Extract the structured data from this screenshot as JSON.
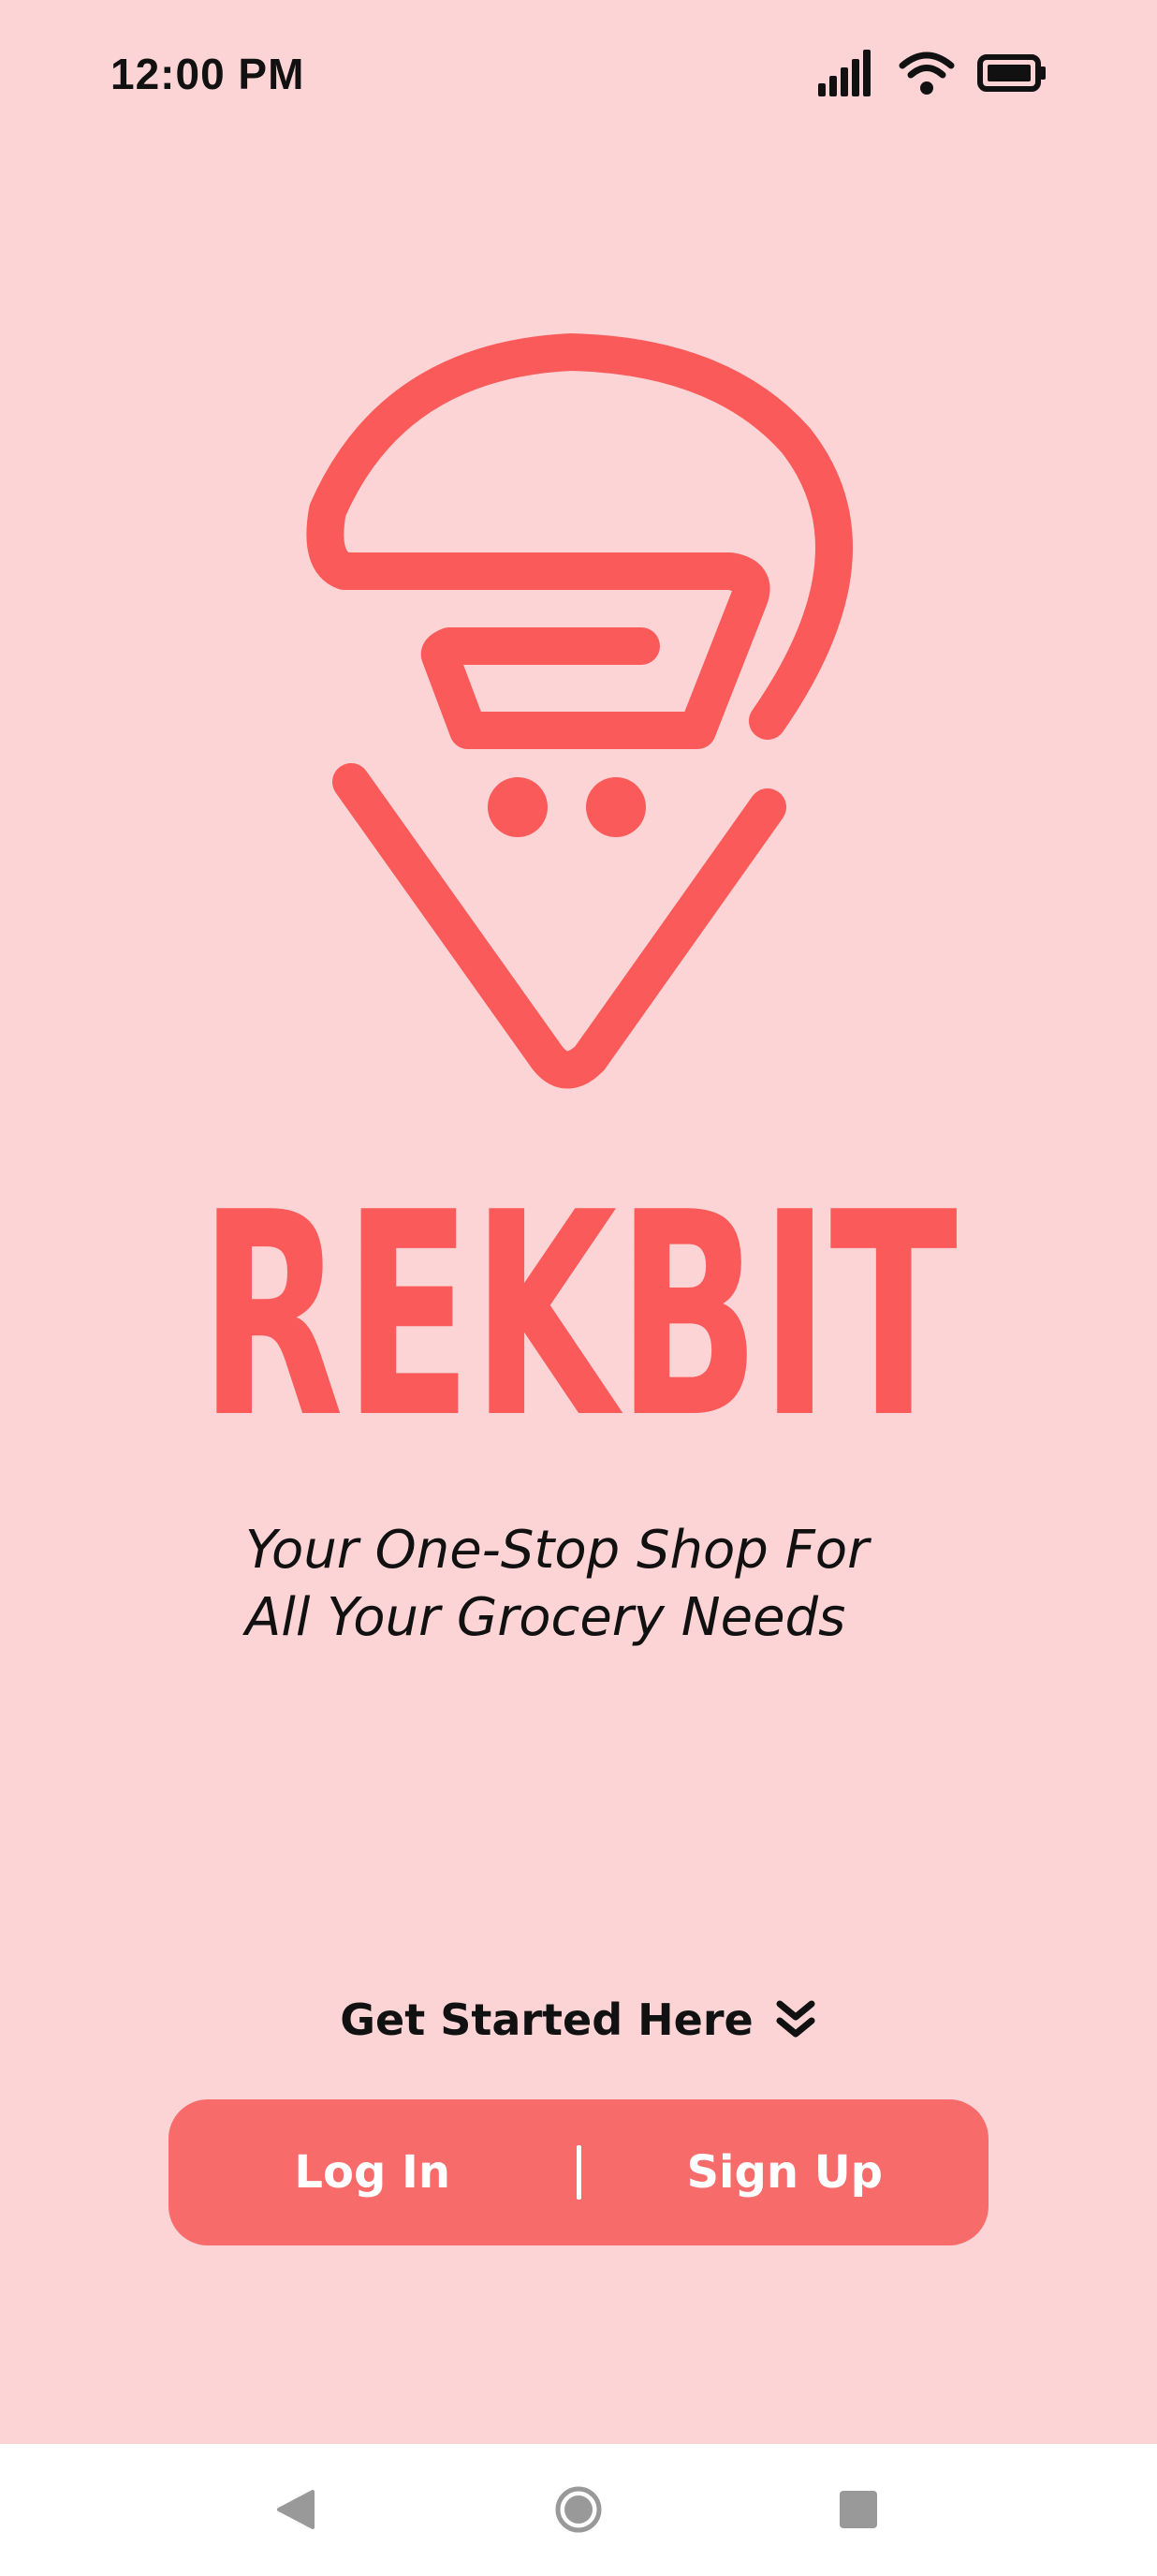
{
  "status_bar": {
    "time": "12:00 PM",
    "icons": [
      "signal-icon",
      "wifi-icon",
      "battery-icon"
    ]
  },
  "brand": {
    "logo_icon": "cart-location-pin-icon",
    "name": "REKBIT",
    "accent_color": "#fa5a5a"
  },
  "tagline": {
    "line1": "Your One-Stop Shop For",
    "line2": "All Your Grocery Needs"
  },
  "get_started": {
    "label": "Get Started Here",
    "icon": "double-chevron-down-icon"
  },
  "auth": {
    "login_label": "Log In",
    "signup_label": "Sign Up",
    "button_color": "#f86b6b"
  },
  "nav_bar": {
    "icons": [
      "back-icon",
      "home-icon",
      "recents-icon"
    ]
  },
  "colors": {
    "background": "#fcd4d5"
  }
}
